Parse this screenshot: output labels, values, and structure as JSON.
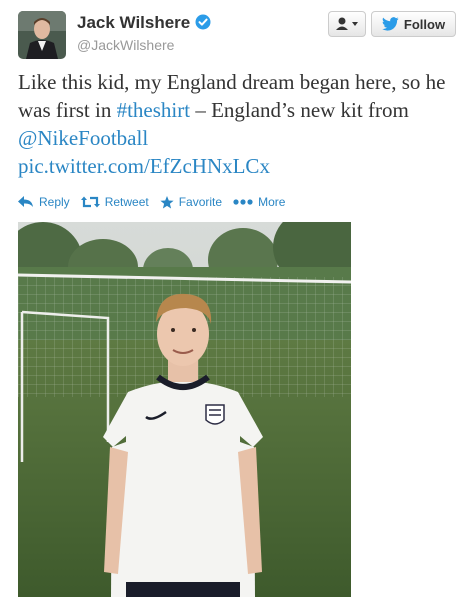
{
  "profile": {
    "name": "Jack Wilshere",
    "handle": "@JackWilshere"
  },
  "buttons": {
    "follow_label": "Follow"
  },
  "tweet": {
    "text_1": "Like this kid, my England dream began here, so he was first in ",
    "hashtag": "#theshirt",
    "text_2": " – England’s new kit from ",
    "mention": "@NikeFootball",
    "link": "pic.twitter.com/EfZcHNxLCx"
  },
  "actions": {
    "reply": "Reply",
    "retweet": "Retweet",
    "favorite": "Favorite",
    "more": "More"
  },
  "colors": {
    "link": "#2a86c4",
    "verified": "#2b9ce8"
  }
}
